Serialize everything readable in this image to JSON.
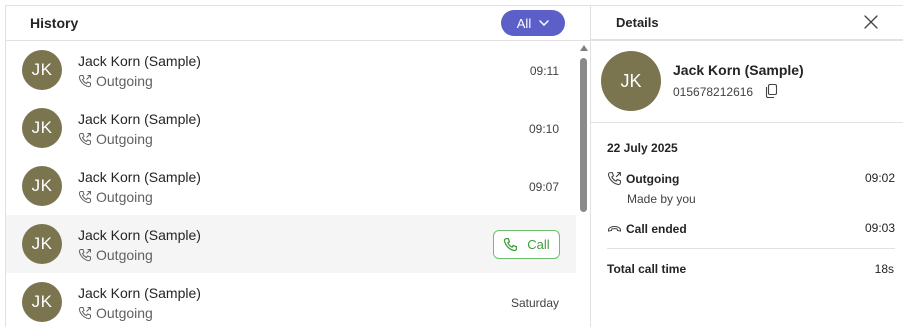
{
  "history": {
    "title": "History",
    "filter_label": "All",
    "rows": [
      {
        "initials": "JK",
        "name": "Jack Korn (Sample)",
        "direction": "Outgoing",
        "time": "09:11"
      },
      {
        "initials": "JK",
        "name": "Jack Korn (Sample)",
        "direction": "Outgoing",
        "time": "09:10"
      },
      {
        "initials": "JK",
        "name": "Jack Korn (Sample)",
        "direction": "Outgoing",
        "time": "09:07"
      },
      {
        "initials": "JK",
        "name": "Jack Korn (Sample)",
        "direction": "Outgoing",
        "call_label": "Call"
      },
      {
        "initials": "JK",
        "name": "Jack Korn (Sample)",
        "direction": "Outgoing",
        "time": "Saturday"
      }
    ]
  },
  "details": {
    "title": "Details",
    "contact": {
      "initials": "JK",
      "name": "Jack Korn (Sample)",
      "phone": "015678212616"
    },
    "date": "22 July 2025",
    "events": [
      {
        "title": "Outgoing",
        "time": "09:02",
        "sub": "Made by you",
        "icon": "outgoing-call-icon"
      },
      {
        "title": "Call ended",
        "time": "09:03",
        "icon": "hang-up-icon"
      }
    ],
    "total_label": "Total call time",
    "total_value": "18s"
  },
  "colors": {
    "accent": "#5b5fc7",
    "avatar": "#7a744f",
    "call_green": "#3e9e3e",
    "hover_row": "#f5f5f5"
  }
}
